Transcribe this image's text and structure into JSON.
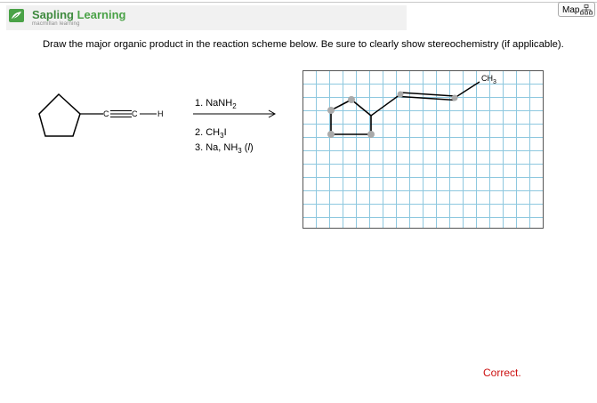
{
  "header": {
    "brand_name_part1": "Sapling",
    "brand_name_part2": "Learning",
    "brand_subtitle": "macmillan learning",
    "logo_icon": "leaf-logo-icon"
  },
  "toolbar": {
    "map_label": "Map",
    "map_icon": "sitemap-icon"
  },
  "question": {
    "text": "Draw the major organic product in the reaction scheme below. Be sure to clearly show stereochemistry (if applicable)."
  },
  "scheme": {
    "starting_material": {
      "alkyne_c_label": "C",
      "alkyne_c2_label": "C",
      "h_label": "H"
    },
    "step1": "1. NaNH",
    "step1_sub": "2",
    "step2": "2. CH",
    "step2_sub": "3",
    "step2_suffix": "I",
    "step3_prefix": "3. Na, NH",
    "step3_sub": "3",
    "step3_suffix": " (",
    "step3_italic": "l",
    "step3_close": ")"
  },
  "canvas": {
    "ch3_label": "CH",
    "ch3_sub": "3"
  },
  "status": {
    "result_text": "Correct.",
    "result_color": "#cc1111"
  },
  "colors": {
    "brand_green": "#3f8a3f",
    "grid_blue": "#8ec8df"
  }
}
